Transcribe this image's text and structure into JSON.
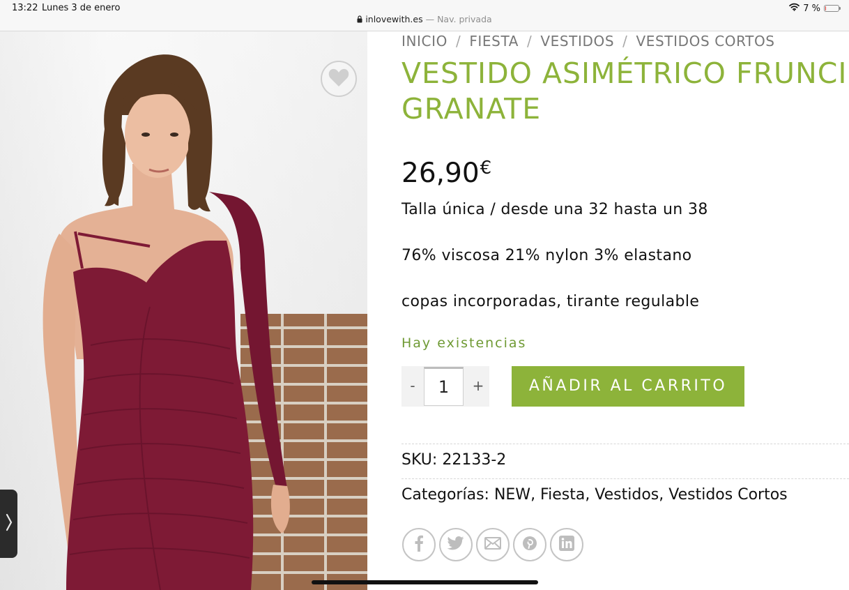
{
  "status_bar": {
    "time": "13:22",
    "date": "Lunes 3 de enero",
    "url": "inlovewith.es",
    "private_label": "— Nav. privada",
    "battery_text": "7 %",
    "battery_level": 0.07,
    "battery_color": "#e0382f"
  },
  "breadcrumb": {
    "items": [
      "INICIO",
      "FIESTA",
      "VESTIDOS",
      "VESTIDOS CORTOS"
    ],
    "separator": "/"
  },
  "product": {
    "title_line1": "VESTIDO ASIMÉTRICO FRUNCIDO",
    "title_line2": "GRANATE",
    "price": "26,90",
    "currency": "€",
    "desc1": "Talla única / desde una 32 hasta un 38",
    "desc2": "76% viscosa 21% nylon 3% elastano",
    "desc3": "copas incorporadas, tirante regulable",
    "stock": "Hay existencias",
    "qty_minus": "-",
    "qty_value": "1",
    "qty_plus": "+",
    "add_to_cart": "AÑADIR AL CARRITO",
    "sku_label": "SKU:",
    "sku": "22133-2",
    "categories_label": "Categorías:",
    "categories": "NEW, Fiesta, Vestidos, Vestidos Cortos"
  },
  "share_icons": [
    "facebook-icon",
    "twitter-icon",
    "email-icon",
    "pinterest-icon",
    "linkedin-icon"
  ],
  "colors": {
    "accent_green": "#8db33a",
    "stock_green": "#6f9a34",
    "dress_burgundy": "#7e1a35"
  }
}
